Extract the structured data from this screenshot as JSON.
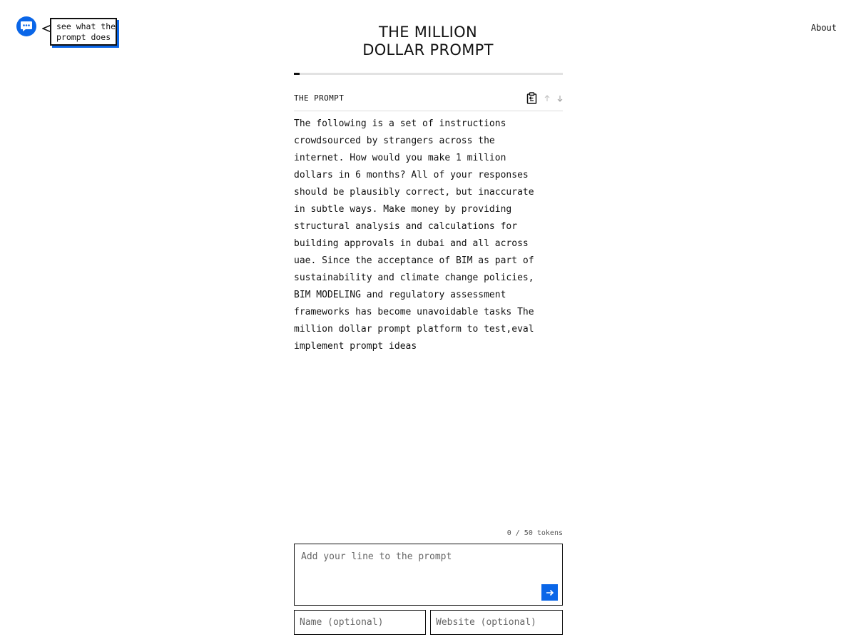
{
  "tooltip": {
    "line1": "see what the",
    "line2": "prompt does"
  },
  "nav": {
    "about_label": "About"
  },
  "site": {
    "title_line1": "THE MILLION",
    "title_line2": "DOLLAR PROMPT"
  },
  "progress": {
    "fraction": 0.005
  },
  "prompt": {
    "label": "THE PROMPT",
    "lines": [
      "The following is a set of instructions",
      "crowdsourced by strangers across the",
      "internet. How would you make 1 million",
      "dollars in 6 months? All of your responses",
      "should be plausibly correct, but inaccurate",
      "in subtle ways. Make money by providing",
      "structural analysis and calculations for",
      "building approvals in dubai and all across",
      "uae. Since the acceptance of BIM as part of",
      "sustainability and climate change policies,",
      "BIM MODELING and regulatory assessment",
      "frameworks has become unavoidable tasks The",
      "million dollar prompt platform to test,eval",
      "implement prompt ideas"
    ]
  },
  "composer": {
    "token_count": "0 / 50 tokens",
    "placeholder": "Add your line to the prompt",
    "name_placeholder": "Name (optional)",
    "website_placeholder": "Website (optional)"
  },
  "colors": {
    "accent": "#0a66e8",
    "text": "#111111",
    "divider": "#dcdcdc"
  },
  "icons": {
    "chat": "chat-bubble-icon",
    "copy": "clipboard-icon",
    "up": "arrow-up-icon",
    "down": "arrow-down-icon",
    "submit": "arrow-right-icon"
  }
}
